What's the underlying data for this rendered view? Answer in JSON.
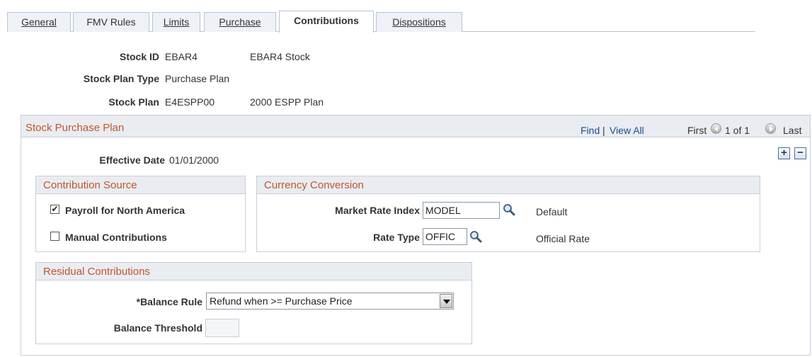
{
  "tabs": [
    {
      "label": "General",
      "active": false
    },
    {
      "label": "FMV Rules",
      "active": false
    },
    {
      "label": "Limits",
      "active": false
    },
    {
      "label": "Purchase",
      "active": false
    },
    {
      "label": "Contributions",
      "active": true
    },
    {
      "label": "Dispositions",
      "active": false
    }
  ],
  "header": {
    "stock_id_label": "Stock ID",
    "stock_id_value": "EBAR4",
    "stock_id_desc": "EBAR4 Stock",
    "plan_type_label": "Stock Plan Type",
    "plan_type_value": "Purchase Plan",
    "stock_plan_label": "Stock Plan",
    "stock_plan_value": "E4ESPP00",
    "stock_plan_desc": "2000 ESPP Plan"
  },
  "panel": {
    "title": "Stock Purchase Plan",
    "find": "Find",
    "separator": "|",
    "view_all": "View All",
    "first": "First",
    "page_info": "1 of 1",
    "last": "Last",
    "add_symbol": "+",
    "delete_symbol": "−",
    "effective_date_label": "Effective Date",
    "effective_date_value": "01/01/2000"
  },
  "contribution_source": {
    "title": "Contribution Source",
    "payroll_label": "Payroll for North America",
    "payroll_checked": "✔",
    "manual_label": "Manual Contributions",
    "manual_checked": ""
  },
  "currency_conversion": {
    "title": "Currency Conversion",
    "market_rate_label": "Market Rate Index",
    "market_rate_value": "MODEL",
    "market_rate_desc": "Default",
    "rate_type_label": "Rate Type",
    "rate_type_value": "OFFIC",
    "rate_type_desc": "Official Rate"
  },
  "residual": {
    "title": "Residual Contributions",
    "balance_rule_label": "*Balance Rule",
    "balance_rule_value": "Refund when >= Purchase Price",
    "balance_threshold_label": "Balance Threshold"
  },
  "colors": {
    "section_title": "#c0572c",
    "link": "#1a4d8f",
    "header_bg": "#e9ecf1",
    "border": "#c9cfd8"
  }
}
